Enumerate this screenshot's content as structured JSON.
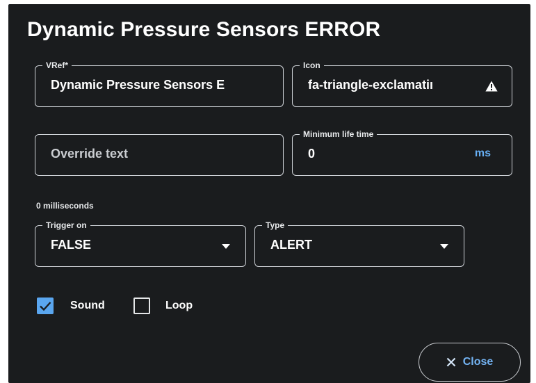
{
  "dialog": {
    "title": "Dynamic Pressure Sensors ERROR"
  },
  "fields": {
    "vref": {
      "label": "VRef*",
      "value": "Dynamic Pressure Sensors E"
    },
    "icon": {
      "label": "Icon",
      "value": "fa-triangle-exclamatiı",
      "icon_name": "triangle-exclamation-icon"
    },
    "override_text": {
      "placeholder": "Override text"
    },
    "min_life_time": {
      "label": "Minimum life time",
      "value": "0",
      "unit": "ms",
      "helper": "0 milliseconds"
    },
    "trigger_on": {
      "label": "Trigger on",
      "value": "FALSE"
    },
    "type": {
      "label": "Type",
      "value": "ALERT"
    }
  },
  "checkboxes": {
    "sound": {
      "label": "Sound",
      "checked": true
    },
    "loop": {
      "label": "Loop",
      "checked": false
    }
  },
  "actions": {
    "close_label": "Close"
  },
  "colors": {
    "background": "#1a1c1e",
    "accent": "#5aa6ef",
    "border": "#cfd3d8"
  }
}
